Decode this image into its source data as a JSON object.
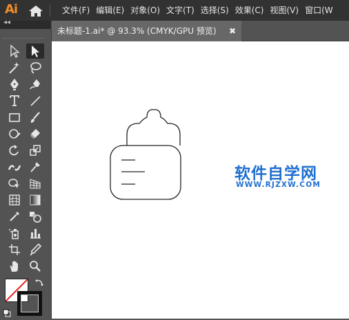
{
  "app": {
    "logo_text": "Ai",
    "brand_color": "#ef8d2a"
  },
  "menu": {
    "items": [
      {
        "label": "文件(F)"
      },
      {
        "label": "编辑(E)"
      },
      {
        "label": "对象(O)"
      },
      {
        "label": "文字(T)"
      },
      {
        "label": "选择(S)"
      },
      {
        "label": "效果(C)"
      },
      {
        "label": "视图(V)"
      },
      {
        "label": "窗口(W"
      }
    ]
  },
  "toolbox": {
    "collapse_icon": "double-chevron-left-icon"
  },
  "document": {
    "tab_title": "未标题-1.ai* @ 93.3% (CMYK/GPU 预览)",
    "close_label": "✖"
  },
  "watermark": {
    "title": "软件自学网",
    "url": "WWW.RJZXW.COM",
    "color": "#1f6fd0"
  },
  "colors": {
    "fill": "none",
    "stroke": "#000000"
  }
}
